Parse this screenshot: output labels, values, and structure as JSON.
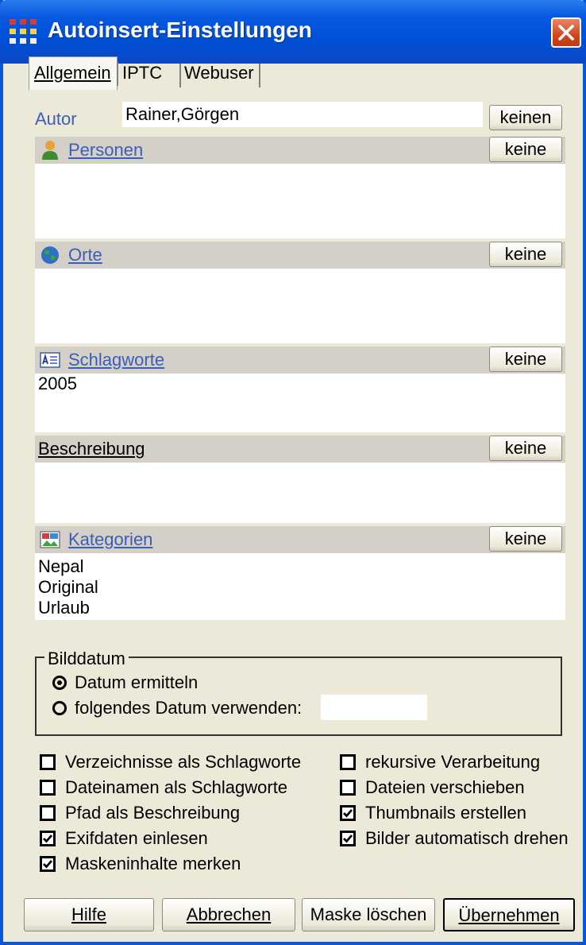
{
  "window": {
    "title": "Autoinsert-Einstellungen"
  },
  "tabs": [
    {
      "label": "Allgemein",
      "active": true
    },
    {
      "label": "IPTC",
      "active": false
    },
    {
      "label": "Webuser",
      "active": false
    }
  ],
  "author": {
    "label": "Autor",
    "value": "Rainer,Görgen",
    "button": "keinen"
  },
  "sections": [
    {
      "label": "Personen",
      "icon": "person-icon",
      "button": "keine",
      "items": []
    },
    {
      "label": "Orte",
      "icon": "globe-icon",
      "button": "keine",
      "items": []
    },
    {
      "label": "Schlagworte",
      "icon": "keyword-icon",
      "button": "keine",
      "items": [
        "2005"
      ]
    },
    {
      "label": "Beschreibung",
      "icon": "",
      "button": "keine",
      "items": []
    },
    {
      "label": "Kategorien",
      "icon": "category-icon",
      "button": "keine",
      "items": [
        "Nepal",
        "Original",
        "Urlaub"
      ]
    }
  ],
  "bilddatum": {
    "legend": "Bilddatum",
    "option1": "Datum ermitteln",
    "option2": "folgendes Datum verwenden:",
    "selected": "option1",
    "date_value": ""
  },
  "checkboxes": {
    "left": [
      {
        "label": "Verzeichnisse als Schlagworte",
        "checked": false
      },
      {
        "label": "Dateinamen als Schlagworte",
        "checked": false
      },
      {
        "label": "Pfad als Beschreibung",
        "checked": false
      },
      {
        "label": "Exifdaten einlesen",
        "checked": true
      },
      {
        "label": "Maskeninhalte merken",
        "checked": true
      }
    ],
    "right": [
      {
        "label": "rekursive Verarbeitung",
        "checked": false
      },
      {
        "label": "Dateien verschieben",
        "checked": false
      },
      {
        "label": "Thumbnails erstellen",
        "checked": true
      },
      {
        "label": "Bilder automatisch drehen",
        "checked": true
      }
    ]
  },
  "buttons": {
    "help": "Hilfe",
    "cancel": "Abbrechen",
    "clear": "Maske löschen",
    "apply": "Übernehmen"
  }
}
